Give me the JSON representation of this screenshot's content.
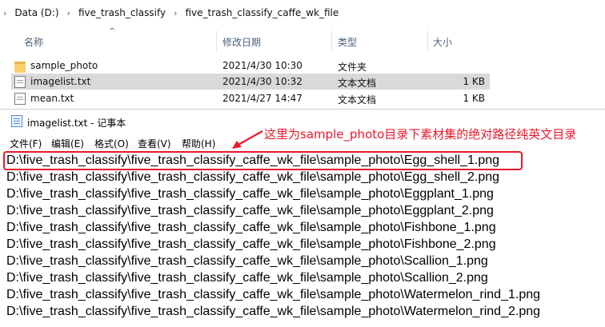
{
  "explorer": {
    "breadcrumb": [
      "Data (D:)",
      "five_trash_classify",
      "five_trash_classify_caffe_wk_file"
    ],
    "columns": {
      "name": "名称",
      "date": "修改日期",
      "type": "类型",
      "size": "大小"
    },
    "files": [
      {
        "name": "sample_photo",
        "date": "2021/4/30 10:30",
        "type": "文件夹",
        "size": "",
        "icon": "folder-icon",
        "selected": false
      },
      {
        "name": "imagelist.txt",
        "date": "2021/4/30 10:32",
        "type": "文本文档",
        "size": "1 KB",
        "icon": "text-file-icon",
        "selected": true
      },
      {
        "name": "mean.txt",
        "date": "2021/4/27 14:47",
        "type": "文本文档",
        "size": "1 KB",
        "icon": "text-file-icon",
        "selected": false
      }
    ]
  },
  "notepad": {
    "title": "imagelist.txt - 记事本",
    "menu": [
      "文件(F)",
      "编辑(E)",
      "格式(O)",
      "查看(V)",
      "帮助(H)"
    ],
    "lines": [
      "D:\\five_trash_classify\\five_trash_classify_caffe_wk_file\\sample_photo\\Egg_shell_1.png",
      "D:\\five_trash_classify\\five_trash_classify_caffe_wk_file\\sample_photo\\Egg_shell_2.png",
      "D:\\five_trash_classify\\five_trash_classify_caffe_wk_file\\sample_photo\\Eggplant_1.png",
      "D:\\five_trash_classify\\five_trash_classify_caffe_wk_file\\sample_photo\\Eggplant_2.png",
      "D:\\five_trash_classify\\five_trash_classify_caffe_wk_file\\sample_photo\\Fishbone_1.png",
      "D:\\five_trash_classify\\five_trash_classify_caffe_wk_file\\sample_photo\\Fishbone_2.png",
      "D:\\five_trash_classify\\five_trash_classify_caffe_wk_file\\sample_photo\\Scallion_1.png",
      "D:\\five_trash_classify\\five_trash_classify_caffe_wk_file\\sample_photo\\Scallion_2.png",
      "D:\\five_trash_classify\\five_trash_classify_caffe_wk_file\\sample_photo\\Watermelon_rind_1.png",
      "D:\\five_trash_classify\\five_trash_classify_caffe_wk_file\\sample_photo\\Watermelon_rind_2.png"
    ]
  },
  "annotation": {
    "text": "这里为sample_photo目录下素材集的绝对路径纯英文目录",
    "color": "#e8192b"
  }
}
